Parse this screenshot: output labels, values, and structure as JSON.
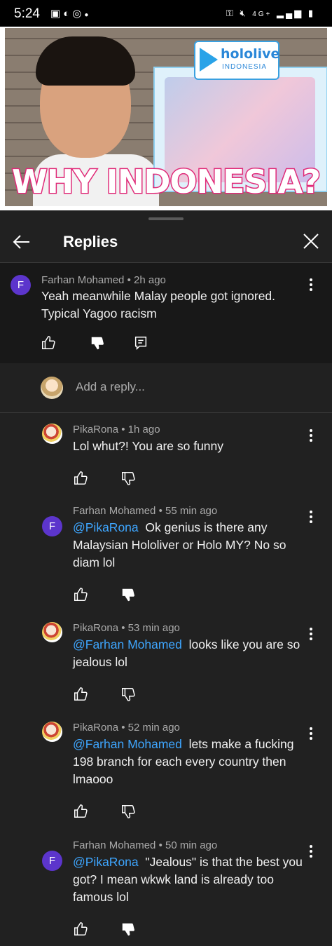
{
  "status_bar": {
    "time": "5:24",
    "left_icons": [
      "gallery-icon",
      "half-circle-icon",
      "cloud-icon",
      "dot-icon"
    ],
    "right_icons": [
      "key-icon",
      "mute-icon",
      "4g-icon",
      "signal-icon",
      "battery-icon"
    ],
    "network": "4G+"
  },
  "video": {
    "headline": "WHY INDONESIA?",
    "logo_text": "hololive",
    "logo_sub": "INDONESIA"
  },
  "header": {
    "title": "Replies"
  },
  "parent_comment": {
    "avatar_letter": "F",
    "author": "Farhan Mohamed",
    "time": "2h ago",
    "text": "Yeah meanwhile Malay people got ignored. Typical Yagoo racism"
  },
  "add_reply": {
    "placeholder": "Add a reply..."
  },
  "replies": [
    {
      "avatar": "P",
      "author": "PikaRona",
      "time": "1h ago",
      "mention": "",
      "text": "Lol whut?! You are so funny",
      "dislike_filled": false
    },
    {
      "avatar": "F",
      "author": "Farhan Mohamed",
      "time": "55 min ago",
      "mention": "@PikaRona",
      "text": "Ok genius is there any Malaysian Hololiver or Holo MY? No so diam lol",
      "dislike_filled": true
    },
    {
      "avatar": "P",
      "author": "PikaRona",
      "time": "53 min ago",
      "mention": "@Farhan Mohamed",
      "text": "looks like you are so jealous lol",
      "dislike_filled": false
    },
    {
      "avatar": "P",
      "author": "PikaRona",
      "time": "52 min ago",
      "mention": "@Farhan Mohamed",
      "text": "lets make a fucking 198 branch for each every country then lmaooo",
      "dislike_filled": false
    },
    {
      "avatar": "F",
      "author": "Farhan Mohamed",
      "time": "50 min ago",
      "mention": "@PikaRona",
      "text": "\"Jealous\" is that the best you got? I mean wkwk land is already too famous lol",
      "dislike_filled": true
    }
  ],
  "separator": "•"
}
